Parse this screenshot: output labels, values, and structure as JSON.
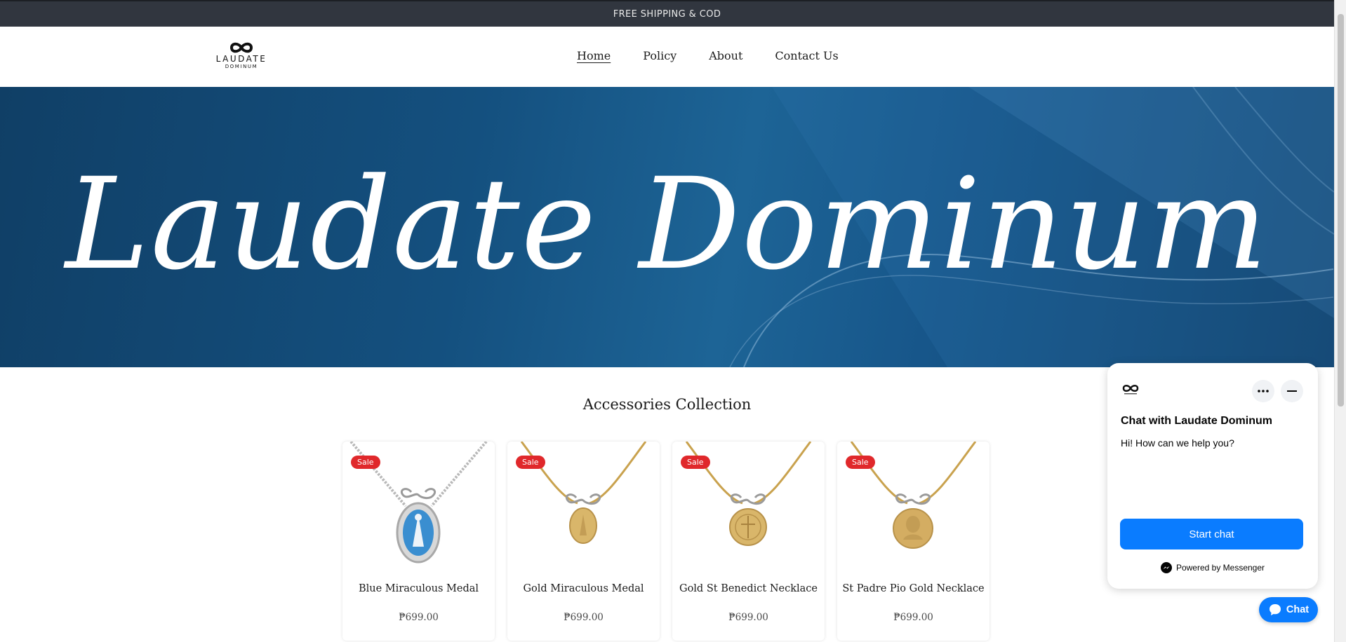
{
  "announcement": "FREE SHIPPING & COD",
  "logo": {
    "word": "LAUDATE",
    "sub": "DOMINUM"
  },
  "nav": [
    {
      "label": "Home",
      "active": true
    },
    {
      "label": "Policy",
      "active": false
    },
    {
      "label": "About",
      "active": false
    },
    {
      "label": "Contact Us",
      "active": false
    }
  ],
  "hero": {
    "title": "Laudate Dominum"
  },
  "collection": {
    "title": "Accessories Collection",
    "products": [
      {
        "name": "Blue Miraculous Medal",
        "price": "₱699.00",
        "badge": "Sale",
        "chain": "silver",
        "medal": "blue"
      },
      {
        "name": "Gold Miraculous Medal",
        "price": "₱699.00",
        "badge": "Sale",
        "chain": "gold",
        "medal": "gold-small"
      },
      {
        "name": "Gold St Benedict Necklace",
        "price": "₱699.00",
        "badge": "Sale",
        "chain": "gold",
        "medal": "gold"
      },
      {
        "name": "St Padre Pio Gold Necklace",
        "price": "₱699.00",
        "badge": "Sale",
        "chain": "gold",
        "medal": "gold"
      }
    ]
  },
  "chat": {
    "title": "Chat with Laudate Dominum",
    "message": "Hi! How can we help you?",
    "start_label": "Start chat",
    "powered_label": "Powered by Messenger",
    "fab_label": "Chat"
  },
  "colors": {
    "announcement_bg": "#31363f",
    "hero_blue": "#14507f",
    "sale_red": "#e0282b",
    "messenger_blue": "#0a7cff"
  }
}
